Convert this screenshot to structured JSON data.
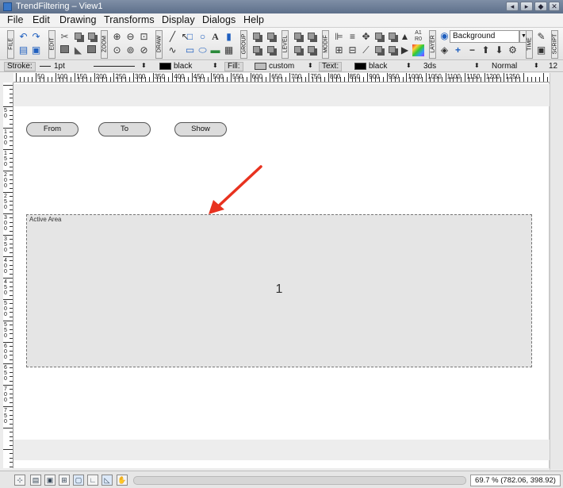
{
  "window": {
    "title": "TrendFiltering – View1"
  },
  "menubar": [
    "File",
    "Edit",
    "Drawing",
    "Transforms",
    "Display",
    "Dialogs",
    "Help"
  ],
  "toolbar": {
    "groups": [
      "FILE",
      "EDIT",
      "ZOOM",
      "DRAW",
      "GROUP",
      "LEVEL",
      "MODIF",
      "LAYER",
      "TIME",
      "SCRIPT"
    ],
    "layer_value": "Background",
    "a1_label": "A1",
    "r0_label": "R0",
    "text_tool_label": "A"
  },
  "properties": {
    "stroke_label": "Stroke:",
    "stroke_width": "1pt",
    "stroke_color_name": "black",
    "fill_label": "Fill:",
    "fill_value": "custom",
    "text_label": "Text:",
    "text_color_name": "black",
    "font_name": "3ds",
    "font_style": "Normal",
    "font_size": "12",
    "colors": {
      "stroke": "#000000",
      "fill": "#bdbdbd",
      "text": "#000000"
    }
  },
  "ruler": {
    "h_labels": [
      "50",
      "100",
      "150",
      "200",
      "250",
      "300",
      "350",
      "400",
      "450",
      "500",
      "550",
      "600",
      "650",
      "700",
      "750",
      "800",
      "850",
      "900",
      "950",
      "1000",
      "1050",
      "1100",
      "1150",
      "1200",
      "1250"
    ],
    "v_labels": [
      "50",
      "100",
      "150",
      "200",
      "250",
      "300",
      "350",
      "400",
      "450",
      "500",
      "550",
      "600",
      "650",
      "700",
      "750"
    ]
  },
  "canvas": {
    "buttons": {
      "from": "From",
      "to": "To",
      "show": "Show"
    },
    "active_area": {
      "label": "Active Area",
      "value": "1"
    },
    "annotation_color": "#e8321f"
  },
  "status": {
    "zoom": "69.7 % (782.06, 398.92)"
  }
}
